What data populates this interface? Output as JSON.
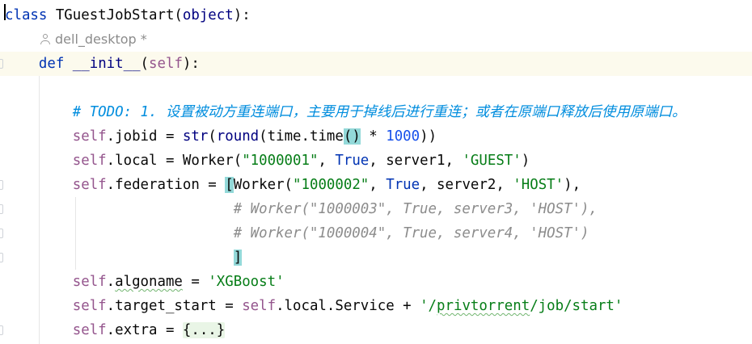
{
  "editor": {
    "lines": [
      {
        "tokens": [
          {
            "k": "kw",
            "t": "class"
          },
          {
            "k": "fn",
            "t": " TGuestJobStart("
          },
          {
            "k": "bi",
            "t": "object"
          },
          {
            "k": "fn",
            "t": "):"
          }
        ]
      },
      {
        "inlay": "dell_desktop *"
      },
      {
        "tokens": [
          {
            "k": "ws",
            "t": "    "
          },
          {
            "k": "kw",
            "t": "def "
          },
          {
            "k": "bi",
            "t": "__init__"
          },
          {
            "k": "fn",
            "t": "("
          },
          {
            "k": "self",
            "t": "self"
          },
          {
            "k": "fn",
            "t": "):"
          }
        ]
      },
      {
        "tokens": []
      },
      {
        "tokens": [
          {
            "k": "ws",
            "t": "        "
          },
          {
            "k": "todo",
            "t": "# TODO: 1. 设置被动方重连端口，主要用于掉线后进行重连；或者在原端口释放后使用原端口。"
          }
        ]
      },
      {
        "tokens": [
          {
            "k": "ws",
            "t": "        "
          },
          {
            "k": "self",
            "t": "self"
          },
          {
            "k": "fn",
            "t": ".jobid = "
          },
          {
            "k": "bi",
            "t": "str"
          },
          {
            "k": "fn",
            "t": "("
          },
          {
            "k": "bi",
            "t": "round"
          },
          {
            "k": "fn",
            "t": "(time.time"
          },
          {
            "k": "brk",
            "t": "()"
          },
          {
            "k": "fn",
            "t": " * "
          },
          {
            "k": "num",
            "t": "1000"
          },
          {
            "k": "fn",
            "t": "))"
          }
        ]
      },
      {
        "tokens": [
          {
            "k": "ws",
            "t": "        "
          },
          {
            "k": "self",
            "t": "self"
          },
          {
            "k": "fn",
            "t": ".local = Worker("
          },
          {
            "k": "str",
            "t": "\"1000001\""
          },
          {
            "k": "fn",
            "t": ", "
          },
          {
            "k": "kw",
            "t": "True"
          },
          {
            "k": "fn",
            "t": ", server1, "
          },
          {
            "k": "str",
            "t": "'GUEST'"
          },
          {
            "k": "fn",
            "t": ")"
          }
        ]
      },
      {
        "tokens": [
          {
            "k": "ws",
            "t": "        "
          },
          {
            "k": "self",
            "t": "self"
          },
          {
            "k": "fn",
            "t": ".federation = "
          },
          {
            "k": "brk",
            "t": "["
          },
          {
            "k": "fn",
            "t": "Worker("
          },
          {
            "k": "str",
            "t": "\"1000002\""
          },
          {
            "k": "fn",
            "t": ", "
          },
          {
            "k": "kw",
            "t": "True"
          },
          {
            "k": "fn",
            "t": ", server2, "
          },
          {
            "k": "str",
            "t": "'HOST'"
          },
          {
            "k": "fn",
            "t": "),"
          }
        ]
      },
      {
        "tokens": [
          {
            "k": "ws",
            "t": "                           "
          },
          {
            "k": "cm",
            "t": "# Worker(\"1000003\", True, server3, 'HOST'),"
          }
        ]
      },
      {
        "tokens": [
          {
            "k": "ws",
            "t": "                           "
          },
          {
            "k": "cm",
            "t": "# Worker(\"1000004\", True, server4, 'HOST')"
          }
        ]
      },
      {
        "tokens": [
          {
            "k": "ws",
            "t": "                           "
          },
          {
            "k": "brk",
            "t": "]"
          }
        ]
      },
      {
        "tokens": [
          {
            "k": "ws",
            "t": "        "
          },
          {
            "k": "self",
            "t": "self"
          },
          {
            "k": "fn",
            "t": "."
          },
          {
            "k": "sq",
            "t": "algoname"
          },
          {
            "k": "fn",
            "t": " = "
          },
          {
            "k": "str",
            "t": "'XGBoost'"
          }
        ]
      },
      {
        "tokens": [
          {
            "k": "ws",
            "t": "        "
          },
          {
            "k": "self",
            "t": "self"
          },
          {
            "k": "fn",
            "t": ".target_start = "
          },
          {
            "k": "self",
            "t": "self"
          },
          {
            "k": "fn",
            "t": ".local.Service + "
          },
          {
            "k": "str",
            "t": "'/"
          },
          {
            "k": "strsq",
            "t": "privtorrent"
          },
          {
            "k": "str",
            "t": "/job/start'"
          }
        ]
      },
      {
        "tokens": [
          {
            "k": "ws",
            "t": "        "
          },
          {
            "k": "self",
            "t": "self"
          },
          {
            "k": "fn",
            "t": ".extra = "
          },
          {
            "k": "fold",
            "t": "{...}"
          }
        ]
      }
    ]
  }
}
